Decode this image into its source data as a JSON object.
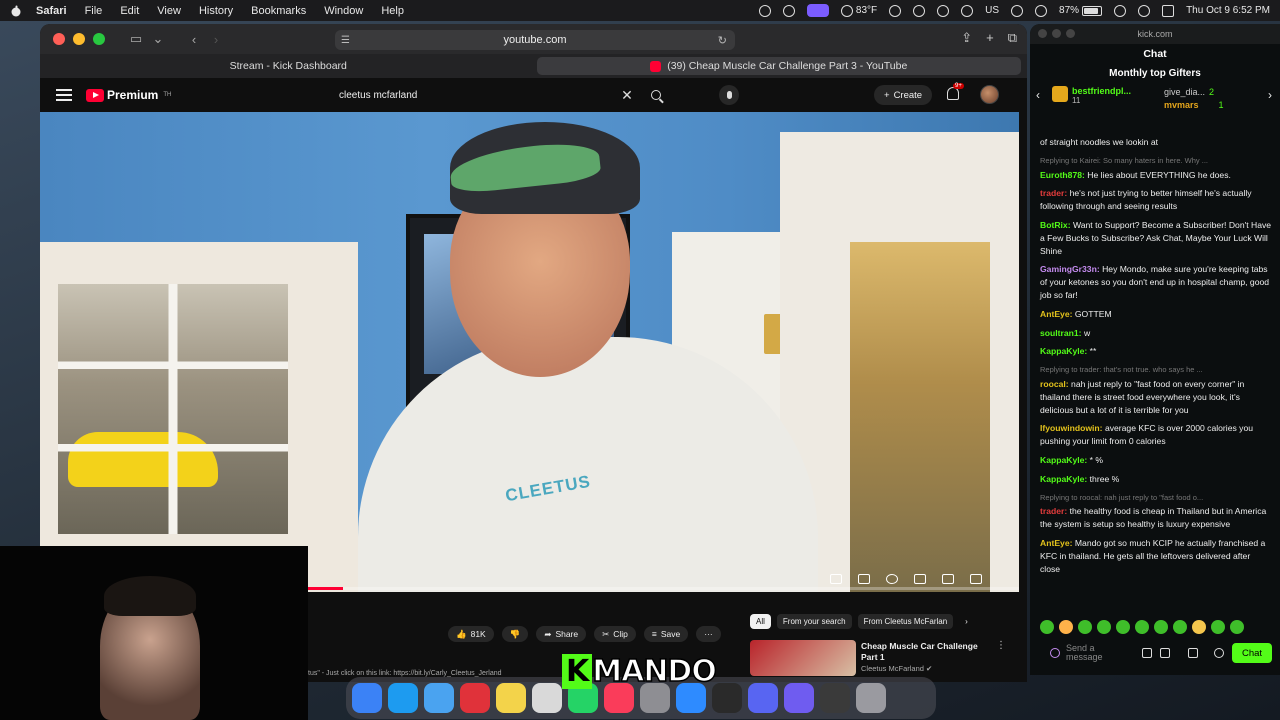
{
  "menubar": {
    "app": "Safari",
    "items": [
      "File",
      "Edit",
      "View",
      "History",
      "Bookmarks",
      "Window",
      "Help"
    ],
    "weather": "83°F",
    "battery": "87%",
    "keyboard": "US",
    "datetime": "Thu Oct 9  6:52 PM"
  },
  "safari": {
    "url": "youtube.com",
    "tabs": [
      {
        "label": "Stream - Kick Dashboard",
        "favicon": "kick-icon"
      },
      {
        "label": "(39) Cheap Muscle Car Challenge Part 3 - YouTube",
        "favicon": "youtube-icon"
      }
    ]
  },
  "youtube": {
    "logo": "Premium",
    "logo_sup": "TH",
    "search_value": "cleetus mcfarland",
    "create_label": "Create",
    "notif_badge": "9+",
    "shirt_text": "CLEETUS",
    "likes": "81K",
    "share_label": "Share",
    "clip_label": "Clip",
    "save_label": "Save",
    "more": "···",
    "chips": [
      "All",
      "From your search",
      "From Cleetus McFarlan"
    ],
    "rec": {
      "title": "Cheap Muscle Car Challenge Part 1",
      "channel": "Cleetus McFarland ✔"
    },
    "desc": "tus\" - Just click on this link: https://bit.ly/Carly_Cleetus_Jerland"
  },
  "overlay": {
    "mando": "MANDO",
    "k": "K"
  },
  "kick": {
    "window_title": "kick.com",
    "chat_title": "Chat",
    "gifters_title": "Monthly top Gifters",
    "gifters": [
      {
        "name": "bestfriendpl...",
        "count": "11"
      },
      {
        "name": "give_dia...",
        "count": "2"
      },
      {
        "name": "mvmars",
        "count": "1"
      }
    ],
    "messages": [
      {
        "reply": "",
        "user": "",
        "color": "#eee",
        "text": "of straight noodles we lookin at"
      },
      {
        "reply": "Replying to Kairei: So many haters in here. Why ...",
        "user": "Euroth878:",
        "color": "#53fc18",
        "text": "He lies about EVERYTHING he does."
      },
      {
        "reply": "",
        "user": "trader:",
        "color": "#e33c3c",
        "text": "he's not just trying to better himself he's actually following through and seeing results"
      },
      {
        "reply": "",
        "user": "BotRix:",
        "color": "#53fc18",
        "text": "Want to Support? Become a Subscriber! Don't Have a Few Bucks to Subscribe? Ask Chat, Maybe Your Luck Will Shine"
      },
      {
        "reply": "",
        "user": "GamingGr33n:",
        "color": "#c58cf0",
        "text": "Hey Mondo, make sure you're keeping tabs of your ketones so you don't end up in hospital champ, good job so far!"
      },
      {
        "reply": "",
        "user": "AntEye:",
        "color": "#e3c21c",
        "text": "GOTTEM"
      },
      {
        "reply": "",
        "user": "soultran1:",
        "color": "#53fc18",
        "text": "w"
      },
      {
        "reply": "",
        "user": "KappaKyle:",
        "color": "#53fc18",
        "text": "**"
      },
      {
        "reply": "Replying to trader: that's not true. who says he ...",
        "user": "roocal:",
        "color": "#e3c21c",
        "text": "nah just reply to \"fast food on every corner\" in thailand there is street food everywhere you look, it's delicious but a lot of it is terrible for you"
      },
      {
        "reply": "",
        "user": "Ifyouwindowin:",
        "color": "#e3c21c",
        "text": "average KFC is over 2000 calories you pushing your limit from 0 calories"
      },
      {
        "reply": "",
        "user": "KappaKyle:",
        "color": "#53fc18",
        "text": "* %"
      },
      {
        "reply": "",
        "user": "KappaKyle:",
        "color": "#53fc18",
        "text": "three %"
      },
      {
        "reply": "Replying to roocal: nah just reply to \"fast food o...",
        "user": "trader:",
        "color": "#e33c3c",
        "text": "the healthy food is cheap in Thailand but in America the system is setup so healthy is luxury expensive"
      },
      {
        "reply": "",
        "user": "AntEye:",
        "color": "#e3c21c",
        "text": "Mando got so much KCIP he actually franchised a KFC in thailand. He gets all the leftovers delivered after close"
      }
    ],
    "input_placeholder": "Send a message",
    "chat_button": "Chat"
  },
  "colors": {
    "kick_green": "#53fc18",
    "yt_red": "#ff0033"
  }
}
